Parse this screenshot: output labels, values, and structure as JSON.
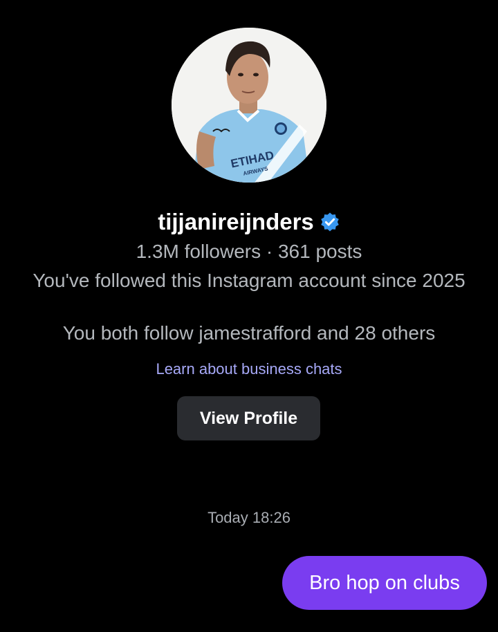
{
  "profile": {
    "avatar_icon": "profile-photo",
    "username": "tijjanireijnders",
    "verified_icon": "verified-badge-icon",
    "verified_color": "#3897f0",
    "stats": "1.3M followers · 361 posts",
    "follow_since": "You've followed this Instagram account since 2025",
    "mutual": "You both follow jamestrafford and 28 others",
    "learn_link": "Learn about business chats",
    "view_profile_label": "View Profile"
  },
  "chat": {
    "timestamp": "Today 18:26",
    "messages": [
      {
        "direction": "outgoing",
        "text": "Bro hop on clubs"
      }
    ],
    "bubble_color": "#7a3df0"
  },
  "colors": {
    "background": "#000000",
    "secondary_text": "#b4b8bd",
    "link": "#a7a9f8",
    "button_bg": "#2a2c30"
  }
}
